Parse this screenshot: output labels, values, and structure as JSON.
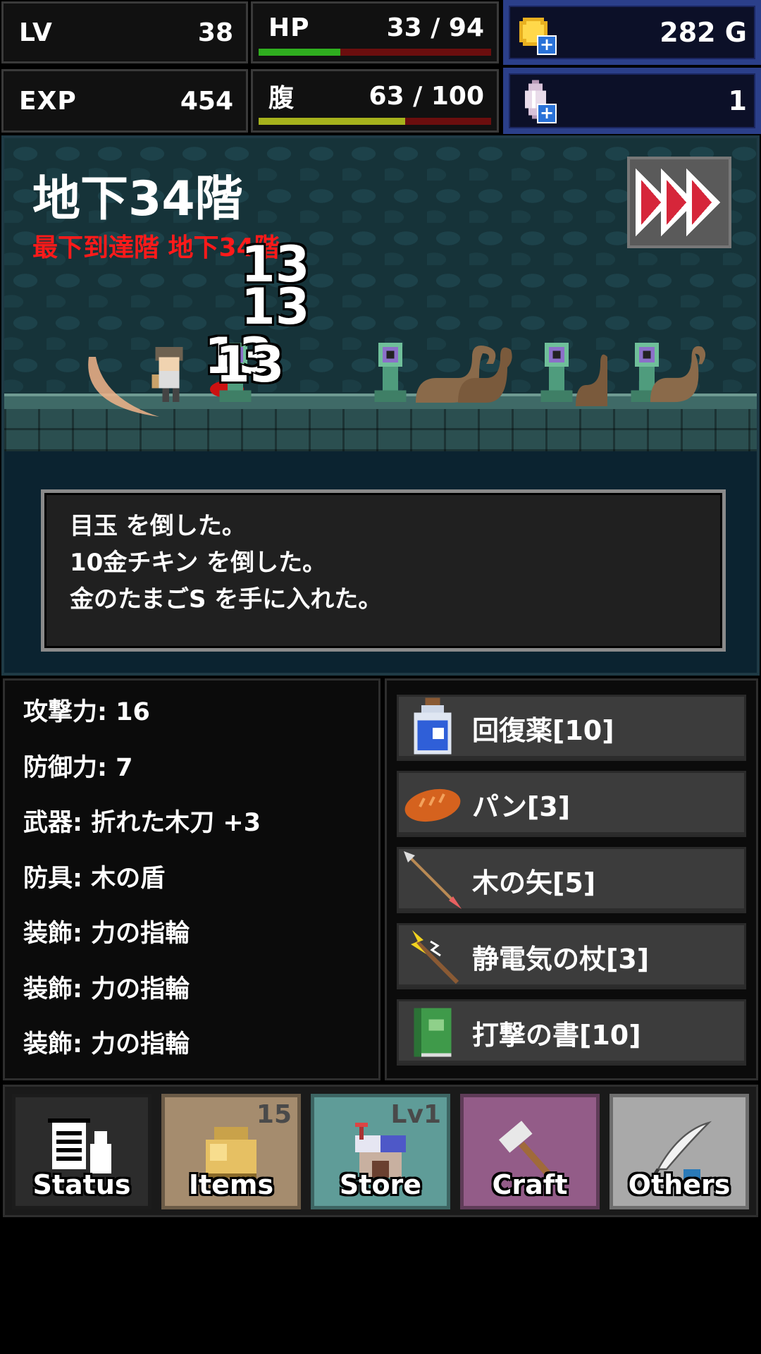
{
  "stats": {
    "lv_label": "LV",
    "lv_value": "38",
    "hp_label": "HP",
    "hp_value": "33 / 94",
    "hp_fraction": 0.35,
    "exp_label": "EXP",
    "exp_value": "454",
    "hunger_label": "腹",
    "hunger_value": "63 / 100",
    "hunger_fraction": 0.63
  },
  "currency": {
    "gold_value": "282 G",
    "crystal_value": "1"
  },
  "battle": {
    "floor": "地下34階",
    "record": "最下到達階 地下34階",
    "damage_numbers": [
      "13",
      "13",
      "13",
      "13"
    ],
    "log": [
      "目玉 を倒した。",
      "10金チキン を倒した。",
      "金のたまごS を手に入れた。"
    ]
  },
  "equipment": [
    "攻撃力: 16",
    "防御力: 7",
    "武器: 折れた木刀 +3",
    "防具: 木の盾",
    "装飾: 力の指輪",
    "装飾: 力の指輪",
    "装飾: 力の指輪"
  ],
  "inventory": [
    {
      "icon": "potion-icon",
      "label": "回復薬[10]"
    },
    {
      "icon": "bread-icon",
      "label": "パン[3]"
    },
    {
      "icon": "arrow-icon",
      "label": "木の矢[5]"
    },
    {
      "icon": "staff-icon",
      "label": "静電気の杖[3]"
    },
    {
      "icon": "book-icon",
      "label": "打撃の書[10]"
    }
  ],
  "nav": {
    "status": {
      "label": "Status",
      "color": "#2c2c2c"
    },
    "items": {
      "label": "Items",
      "badge": "15",
      "color": "#a58c6e"
    },
    "store": {
      "label": "Store",
      "badge": "Lv1",
      "color": "#5f9c98"
    },
    "craft": {
      "label": "Craft",
      "color": "#935c88"
    },
    "others": {
      "label": "Others",
      "color": "#a9a9a9"
    }
  },
  "colors": {
    "hp_bar": "#2fae1f",
    "hunger_bar": "#a6b21c",
    "bar_empty": "#6b0e0e",
    "record_text": "#ff1a1a",
    "currency_border": "#2b3f8a"
  }
}
